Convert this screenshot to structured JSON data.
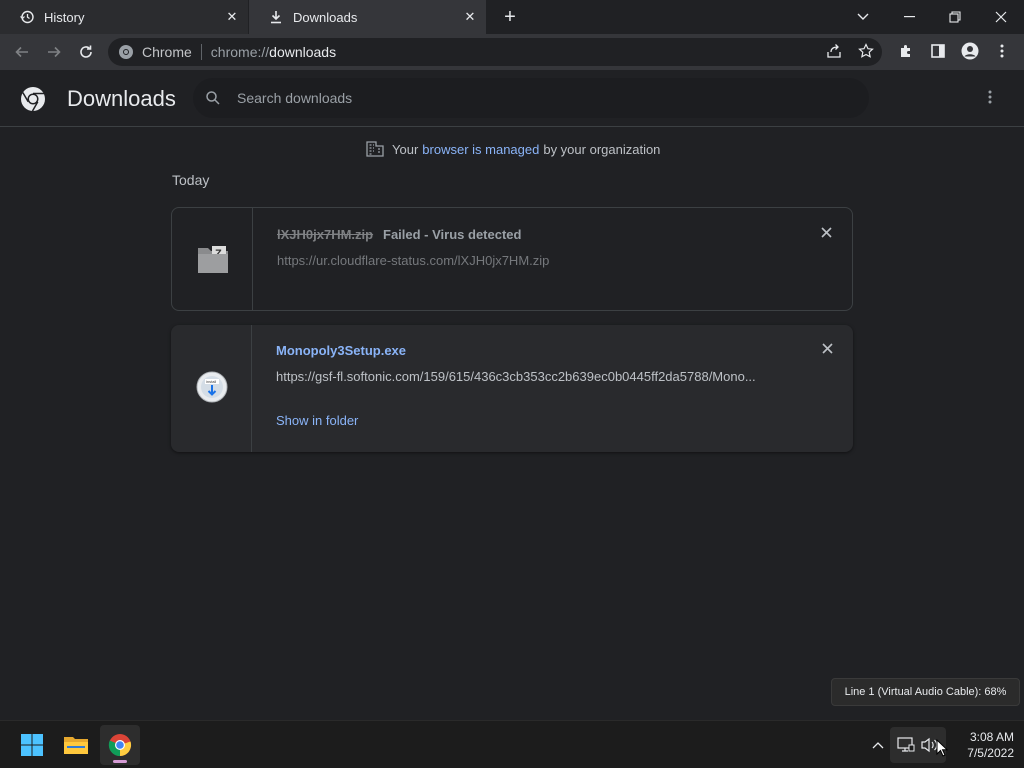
{
  "tabs": [
    {
      "label": "History",
      "icon": "history-icon"
    },
    {
      "label": "Downloads",
      "icon": "download-icon"
    }
  ],
  "window": {
    "controls": [
      "tab-search",
      "minimize",
      "restore",
      "close"
    ]
  },
  "omnibox": {
    "chip": "Chrome",
    "url_scheme": "chrome://",
    "url_host": "downloads"
  },
  "page": {
    "title": "Downloads",
    "search_placeholder": "Search downloads"
  },
  "managed": {
    "prefix": "Your",
    "link": "browser is managed",
    "suffix": "by your organization"
  },
  "section": {
    "date_label": "Today"
  },
  "downloads": [
    {
      "filename": "lXJH0jx7HM.zip",
      "status": "Failed - Virus detected",
      "url": "https://ur.cloudflare-status.com/lXJH0jx7HM.zip",
      "icon": "zip-file-icon"
    },
    {
      "filename": "Monopoly3Setup.exe",
      "url": "https://gsf-fl.softonic.com/159/615/436c3cb353cc2b639ec0b0445ff2da5788/Mono...",
      "action": "Show in folder",
      "icon": "installer-icon"
    }
  ],
  "tooltip": "Line 1 (Virtual Audio Cable): 68%",
  "taskbar": {
    "apps": [
      "start-icon",
      "file-explorer-icon",
      "chrome-icon"
    ],
    "time": "3:08 AM",
    "date": "7/5/2022"
  }
}
